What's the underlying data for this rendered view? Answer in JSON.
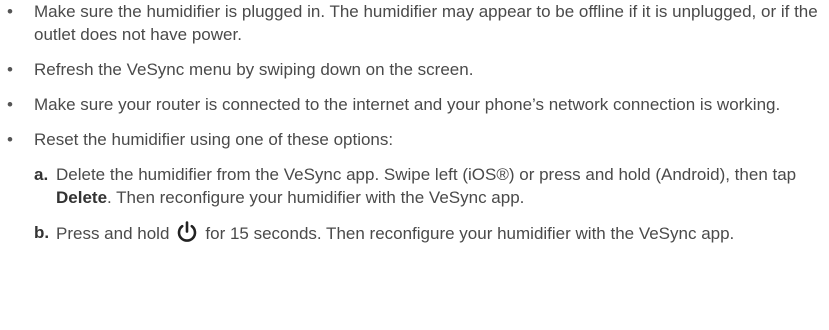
{
  "bullet_glyph": "•",
  "items": [
    {
      "text": "Make sure the humidifier is plugged in. The humidifier may appear to be offline if it is unplugged, or if the outlet does not have power."
    },
    {
      "text": "Refresh the VeSync menu by swiping down on the screen."
    },
    {
      "text": "Make sure your router is connected to the internet and your phone’s network connection is working."
    },
    {
      "text": "Reset the humidifier using one of these options:"
    }
  ],
  "sub_items": [
    {
      "marker": "a.",
      "text_before": "Delete the humidifier from the VeSync app. Swipe left (iOS®) or press and hold (Android), then tap ",
      "bold": "Delete",
      "text_after": ". Then reconfigure your humidifier with the VeSync app."
    },
    {
      "marker": "b.",
      "text_before": "Press and hold",
      "icon": "power-icon",
      "text_after": "for 15 seconds. Then reconfigure your humidifier with the VeSync app."
    }
  ]
}
